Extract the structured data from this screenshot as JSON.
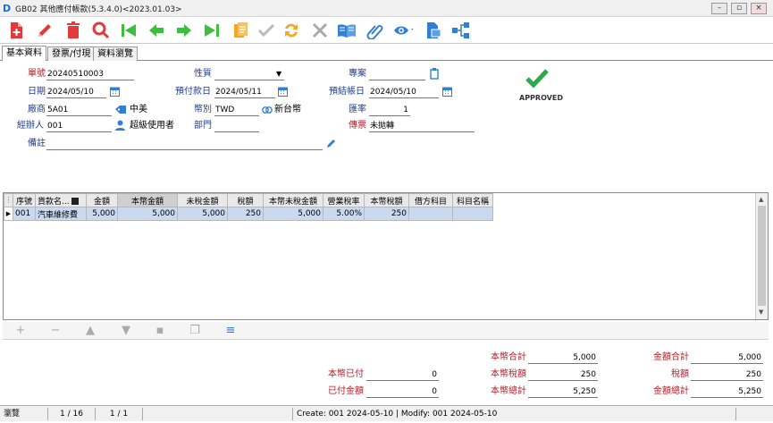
{
  "window": {
    "title": "GB02 其他應付帳款(5.3.4.0)<2023.01.03>",
    "logo": "D"
  },
  "toolbar": {
    "icons": [
      "new-doc-icon",
      "edit-icon",
      "delete-icon",
      "search-icon",
      "first-icon",
      "prev-icon",
      "next-icon",
      "last-icon",
      "copy-doc-icon",
      "confirm-icon",
      "refresh-icon",
      "cancel-icon",
      "book-icon",
      "attach-icon",
      "view-icon",
      "export-icon",
      "flow-icon"
    ]
  },
  "tabs": [
    "基本資料",
    "發票/付現",
    "資料瀏覽"
  ],
  "form": {
    "doc_no_label": "單號",
    "doc_no": "20240510003",
    "nature_label": "性質",
    "nature": "",
    "project_label": "專案",
    "project": "",
    "date_label": "日期",
    "date": "2024/05/10",
    "paydate_label": "預付款日",
    "paydate": "2024/05/11",
    "closedate_label": "預結帳日",
    "closedate": "2024/05/10",
    "vendor_label": "廠商",
    "vendor_code": "5A01",
    "vendor_name": "中美",
    "currency_label": "幣別",
    "currency_code": "TWD",
    "currency_name": "新台幣",
    "rate_label": "匯率",
    "rate": "1",
    "handler_label": "經辦人",
    "handler_code": "001",
    "handler_name": "超級使用者",
    "dept_label": "部門",
    "dept": "",
    "transfer_label": "傳票",
    "transfer": "未拋轉",
    "note_label": "備註",
    "note": "",
    "stamp": "APPROVED"
  },
  "grid": {
    "columns": [
      "序號",
      "貨款名...",
      "金額",
      "本幣金額",
      "未稅金額",
      "稅額",
      "本幣未稅金額",
      "營業稅率",
      "本幣稅額",
      "借方科目",
      "科目名稱"
    ],
    "rows": [
      [
        "001",
        "汽車維修費",
        "5,000",
        "5,000",
        "5,000",
        "250",
        "5,000",
        "5.00%",
        "250",
        "",
        ""
      ]
    ]
  },
  "totals": {
    "local_paid_label": "本幣已付",
    "local_paid": "0",
    "paid_amount_label": "已付金額",
    "paid_amount": "0",
    "local_sum_label": "本幣合計",
    "local_sum": "5,000",
    "local_tax_label": "本幣稅額",
    "local_tax": "250",
    "local_total_label": "本幣總計",
    "local_total": "5,250",
    "amount_sum_label": "金額合計",
    "amount_sum": "5,000",
    "tax_label": "稅額",
    "tax": "250",
    "amount_total_label": "金額總計",
    "amount_total": "5,250"
  },
  "status": {
    "mode": "瀏覽",
    "record": "1 / 16",
    "page": "1 / 1",
    "audit": "Create: 001 2024-05-10 | Modify: 001 2024-05-10"
  }
}
